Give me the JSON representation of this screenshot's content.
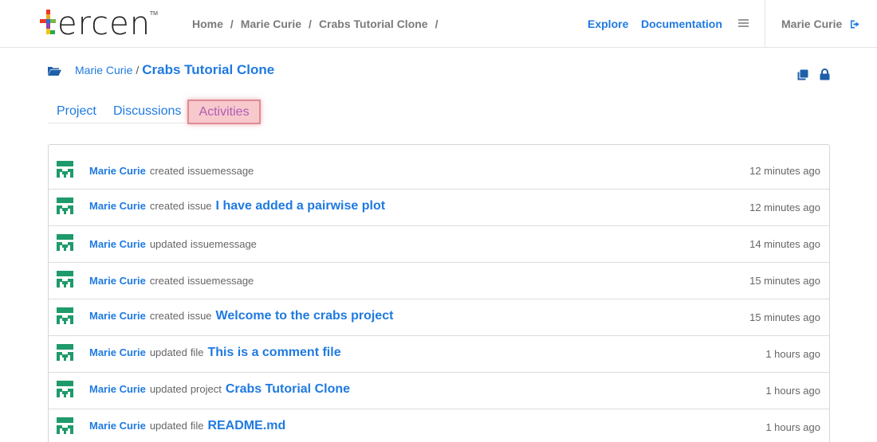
{
  "app": {
    "logo_text": "ercen",
    "logo_tm": "TM"
  },
  "breadcrumb": {
    "items": [
      "Home",
      "Marie Curie",
      "Crabs Tutorial Clone"
    ],
    "separator": "/"
  },
  "nav": {
    "explore": "Explore",
    "documentation": "Documentation",
    "user": "Marie Curie"
  },
  "project": {
    "owner": "Marie Curie",
    "separator": "/",
    "title": "Crabs Tutorial Clone"
  },
  "tabs": {
    "project": "Project",
    "discussions": "Discussions",
    "activities": "Activities",
    "active": "Activities"
  },
  "activities": [
    {
      "actor": "Marie Curie",
      "verb": "created",
      "object": "issuemessage",
      "target": "",
      "time": "12 minutes ago"
    },
    {
      "actor": "Marie Curie",
      "verb": "created",
      "object": "issue",
      "target": "I have added a pairwise plot",
      "time": "12 minutes ago"
    },
    {
      "actor": "Marie Curie",
      "verb": "updated",
      "object": "issuemessage",
      "target": "",
      "time": "14 minutes ago"
    },
    {
      "actor": "Marie Curie",
      "verb": "created",
      "object": "issuemessage",
      "target": "",
      "time": "15 minutes ago"
    },
    {
      "actor": "Marie Curie",
      "verb": "created",
      "object": "issue",
      "target": "Welcome to the crabs project",
      "time": "15 minutes ago"
    },
    {
      "actor": "Marie Curie",
      "verb": "updated",
      "object": "file",
      "target": "This is a comment file",
      "time": "1 hours ago"
    },
    {
      "actor": "Marie Curie",
      "verb": "updated",
      "object": "project",
      "target": "Crabs Tutorial Clone",
      "time": "1 hours ago"
    },
    {
      "actor": "Marie Curie",
      "verb": "updated",
      "object": "file",
      "target": "README.md",
      "time": "1 hours ago"
    }
  ],
  "colors": {
    "accent": "#1f7ae0",
    "avatar": "#1f9a6b",
    "highlight": "#f7c9cc"
  },
  "icons": [
    "folder-icon",
    "menu-icon",
    "sign-out-icon",
    "copy-icon",
    "lock-icon",
    "avatar-icon"
  ]
}
